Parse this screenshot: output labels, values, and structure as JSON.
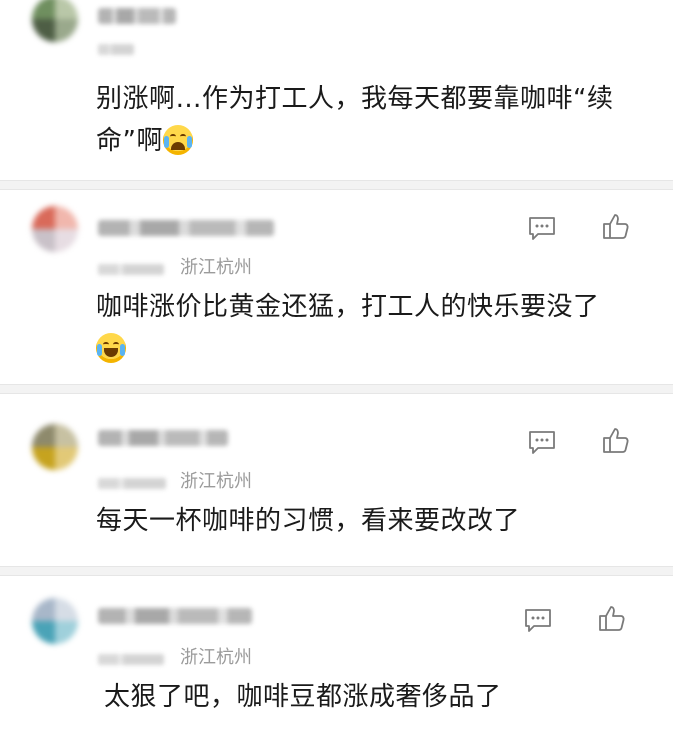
{
  "comments": [
    {
      "text": "别涨啊…作为打工人，我每天都要靠咖啡“续命”啊",
      "emoji": "loudly-crying-face",
      "location": "",
      "colors": {
        "avatar": [
          "#6f8f5f",
          "#b9c7a8",
          "#4e5e45",
          "#9aa98c"
        ]
      }
    },
    {
      "text": "咖啡涨价比黄金还猛，打工人的快乐要没了",
      "emoji": "face-with-tears-of-joy",
      "location": "浙江杭州",
      "colors": {
        "avatar": [
          "#d96a5a",
          "#f1b7ad",
          "#c9c1c8",
          "#e7dde3"
        ]
      }
    },
    {
      "text": "每天一杯咖啡的习惯，看来要改改了",
      "emoji": "",
      "location": "浙江杭州",
      "colors": {
        "avatar": [
          "#8e8a6c",
          "#c7c1a2",
          "#c6a31f",
          "#e2c977"
        ]
      }
    },
    {
      "text": "太狠了吧，咖啡豆都涨成奢侈品了",
      "emoji": "",
      "location": "浙江杭州",
      "colors": {
        "avatar": [
          "#a8b7c9",
          "#d6dde6",
          "#4aa3b7",
          "#9fd0db"
        ]
      }
    }
  ],
  "icons": {
    "reply": "comment-bubble-icon",
    "like": "thumbs-up-icon"
  }
}
